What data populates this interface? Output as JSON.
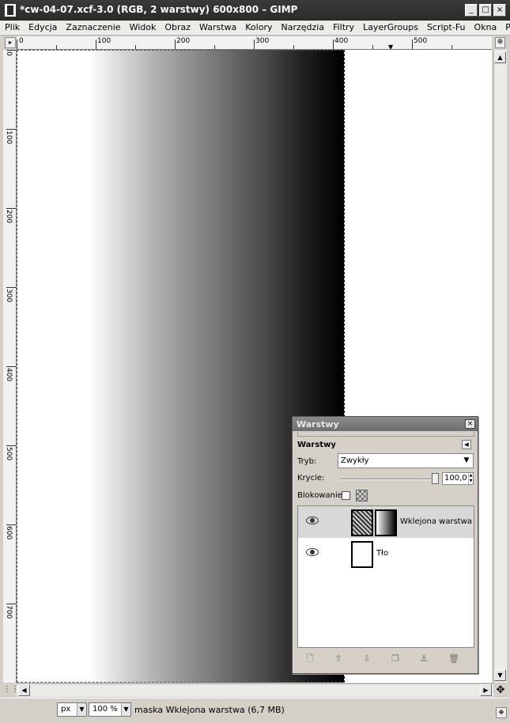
{
  "window": {
    "title": "*cw-04-07.xcf-3.0 (RGB, 2 warstwy) 600x800 – GIMP",
    "buttons": [
      "_",
      "□",
      "×"
    ]
  },
  "menu": [
    "Plik",
    "Edycja",
    "Zaznaczenie",
    "Widok",
    "Obraz",
    "Warstwa",
    "Kolory",
    "Narzędzia",
    "Filtry",
    "LayerGroups",
    "Script-Fu",
    "Okna",
    "Pomoc"
  ],
  "ruler": {
    "h_labels": [
      "0",
      "100",
      "200",
      "300",
      "400",
      "500"
    ],
    "v_labels": [
      "0",
      "100",
      "200",
      "300",
      "400",
      "500",
      "600",
      "700"
    ]
  },
  "statusbar": {
    "unit": "px",
    "zoom": "100 %",
    "message": "maska Wklejona warstwa (6,7 MB)"
  },
  "layers_dialog": {
    "title": "Warstwy",
    "heading": "Warstwy",
    "mode_label": "Tryb:",
    "mode_value": "Zwykły",
    "opacity_label": "Krycie:",
    "opacity_value": "100,0",
    "lock_label": "Blokowanie:",
    "layers": [
      {
        "name": "Wklejona warstwa",
        "visible": true,
        "selected": true,
        "has_mask": true
      },
      {
        "name": "Tło",
        "visible": true,
        "selected": false,
        "has_mask": false
      }
    ],
    "toolbar_icons": [
      "new-layer-icon",
      "raise-layer-icon",
      "lower-layer-icon",
      "duplicate-layer-icon",
      "anchor-layer-icon",
      "delete-layer-icon"
    ]
  }
}
